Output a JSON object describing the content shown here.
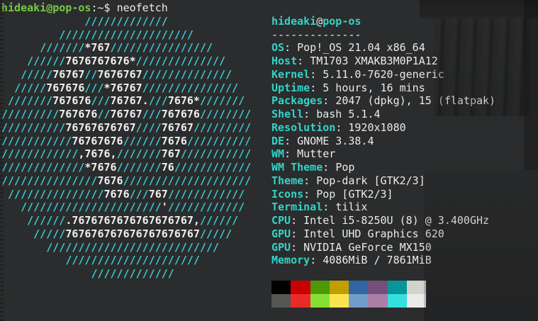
{
  "terminal": {
    "colors": {
      "background": "#2b2c2d",
      "foreground": "#eeeeec",
      "accent_cyan": "#33d6ca",
      "art_cyan": "#38d2d8",
      "art_white": "#f2f2f0",
      "prompt_green": "#77cb47"
    },
    "prompt": {
      "user_host": "hideaki@pop-os",
      "suffix": ":~$ ",
      "command": "neofetch"
    },
    "ascii_logo": {
      "lines": [
        "             /////////////",
        "         /////////////////////",
        "      ///////*767////////////////",
        "    //////7676767676*//////////////",
        "   /////76767//7676767//////////////",
        "  /////767676///*76767///////////////",
        " ///////767676///76767.///7676*///////",
        "/////////767676//76767///767676////////",
        "//////////76767676767////76767/////////",
        "///////////76767676//////7676//////////",
        "////////////,7676,///////767///////////",
        "/////////////*7676///////76////////////",
        "///////////////7676////////////////////",
        " ///////////////7676///767////////////",
        "   //////////////////////'////////////",
        "    //////.7676767676767676767,//////",
        "     /////767676767676767676767/////",
        "       ///////////////////////////",
        "          /////////////////////",
        "              /////////////"
      ]
    },
    "info": {
      "title_user": "hideaki",
      "title_at": "@",
      "title_host": "pop-os",
      "underline": "--------------",
      "entries": [
        {
          "label": "OS",
          "value": "Pop!_OS 21.04 x86_64"
        },
        {
          "label": "Host",
          "value": "TM1703 XMAKB3M0P1A12"
        },
        {
          "label": "Kernel",
          "value": "5.11.0-7620-generic"
        },
        {
          "label": "Uptime",
          "value": "5 hours, 16 mins"
        },
        {
          "label": "Packages",
          "value": "2047 (dpkg), 15 (flatpak)"
        },
        {
          "label": "Shell",
          "value": "bash 5.1.4"
        },
        {
          "label": "Resolution",
          "value": "1920x1080"
        },
        {
          "label": "DE",
          "value": "GNOME 3.38.4"
        },
        {
          "label": "WM",
          "value": "Mutter"
        },
        {
          "label": "WM Theme",
          "value": "Pop"
        },
        {
          "label": "Theme",
          "value": "Pop-dark [GTK2/3]"
        },
        {
          "label": "Icons",
          "value": "Pop [GTK2/3]"
        },
        {
          "label": "Terminal",
          "value": "tilix"
        },
        {
          "label": "CPU",
          "value": "Intel i5-8250U (8) @ 3.400GHz"
        },
        {
          "label": "GPU",
          "value": "Intel UHD Graphics 620"
        },
        {
          "label": "GPU",
          "value": "NVIDIA GeForce MX150"
        },
        {
          "label": "Memory",
          "value": "4086MiB / 7861MiB"
        }
      ]
    },
    "palette": {
      "normal": [
        "#000000",
        "#cc0000",
        "#4e9a06",
        "#c4a000",
        "#3465a4",
        "#75507b",
        "#06989a",
        "#d3d7cf"
      ],
      "bright": [
        "#555753",
        "#ef2929",
        "#8ae234",
        "#fce94f",
        "#729fcf",
        "#ad7fa8",
        "#34e2e2",
        "#eeeeec"
      ]
    }
  }
}
